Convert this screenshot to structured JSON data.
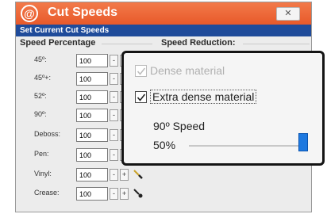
{
  "window": {
    "title": "Cut Speeds",
    "logo_glyph": "@",
    "close_glyph": "✕"
  },
  "section_header": "Set Current Cut Speeds",
  "columns": {
    "speed_percentage": "Speed Percentage",
    "speed_reduction": "Speed Reduction:"
  },
  "rows": [
    {
      "label": "45º:",
      "value": "100"
    },
    {
      "label": "45º+:",
      "value": "100"
    },
    {
      "label": "52º:",
      "value": "100"
    },
    {
      "label": "90º:",
      "value": "100"
    },
    {
      "label": "Deboss:",
      "value": "100"
    },
    {
      "label": "Pen:",
      "value": "100"
    },
    {
      "label": "Vinyl:",
      "value": "100",
      "icon": "knife-icon"
    },
    {
      "label": "Crease:",
      "value": "100",
      "icon": "crease-tool-icon"
    }
  ],
  "stepper": {
    "minus": "-",
    "plus": "+"
  },
  "popup": {
    "options": [
      {
        "label": "Dense material",
        "checked": true,
        "disabled": true
      },
      {
        "label": "Extra dense material",
        "checked": true,
        "disabled": false
      }
    ],
    "speed_title": "90º Speed",
    "speed_value": "50%",
    "slider_fraction": 1.0
  },
  "colors": {
    "titlebar": "#e8592a",
    "section_header": "#1f4b9a",
    "slider_thumb": "#1e79e0"
  }
}
